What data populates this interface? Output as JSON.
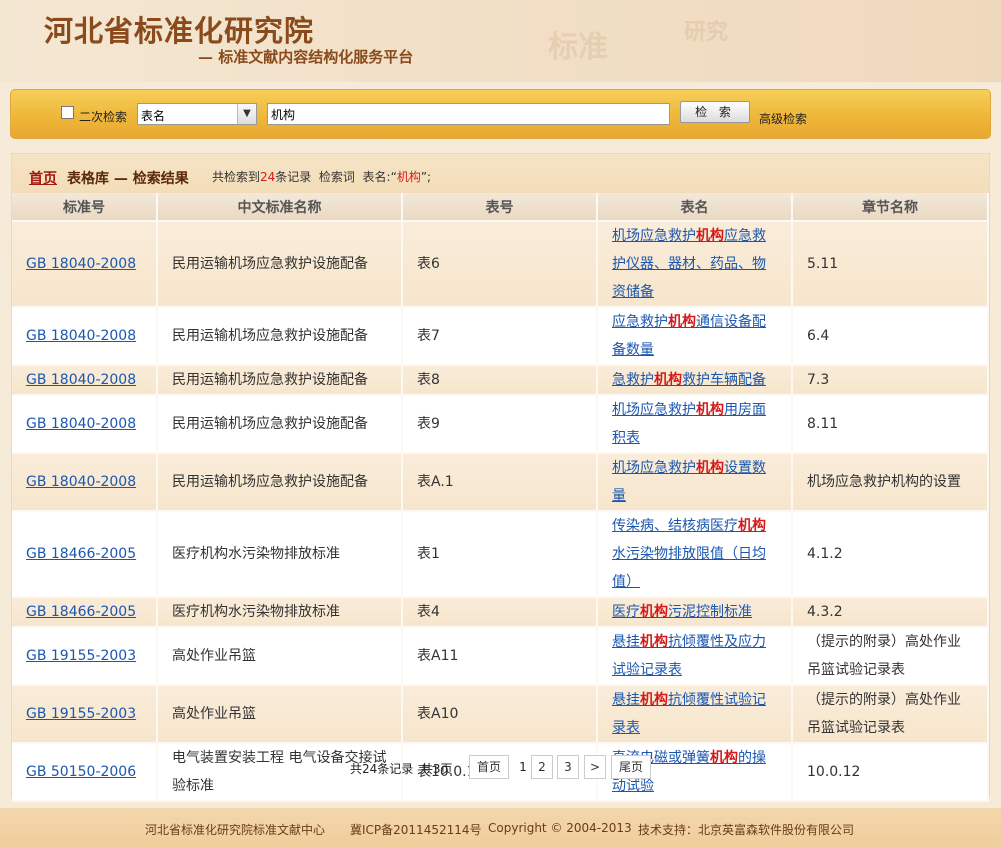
{
  "header": {
    "title": "河北省标准化研究院",
    "subtitle": "— 标准文献内容结构化服务平台",
    "watermark_1": "标准",
    "watermark_2": "研究"
  },
  "search": {
    "secondary_search_label": "二次检索",
    "secondary_search_checked": false,
    "field_select_value": "表名",
    "query_value": "机构",
    "search_button": "检 索",
    "advanced_link": "高级检索"
  },
  "breadcrumb": {
    "home": "首页",
    "rest": "表格库 — 检索结果",
    "stats_prefix": "共检索到",
    "count": "24",
    "stats_mid": "条记录  检索词  表名:“",
    "term": "机构",
    "stats_suffix": "”;"
  },
  "table": {
    "columns": [
      "标准号",
      "中文标准名称",
      "表号",
      "表名",
      "章节名称"
    ],
    "rows": [
      {
        "std": "GB 18040-2008",
        "name": "民用运输机场应急救护设施配备",
        "no": "表6",
        "title_pre": "机场应急救护",
        "title_hl": "机构",
        "title_post": "应急救护仪器、器材、药品、物资储备",
        "section": "5.11"
      },
      {
        "std": "GB 18040-2008",
        "name": "民用运输机场应急救护设施配备",
        "no": "表7",
        "title_pre": "应急救护",
        "title_hl": "机构",
        "title_post": "通信设备配备数量",
        "section": "6.4"
      },
      {
        "std": "GB 18040-2008",
        "name": "民用运输机场应急救护设施配备",
        "no": "表8",
        "title_pre": "急救护",
        "title_hl": "机构",
        "title_post": "救护车辆配备",
        "section": "7.3"
      },
      {
        "std": "GB 18040-2008",
        "name": "民用运输机场应急救护设施配备",
        "no": "表9",
        "title_pre": "机场应急救护",
        "title_hl": "机构",
        "title_post": "用房面积表",
        "section": "8.11"
      },
      {
        "std": "GB 18040-2008",
        "name": "民用运输机场应急救护设施配备",
        "no": "表A.1",
        "title_pre": "机场应急救护",
        "title_hl": "机构",
        "title_post": "设置数量",
        "section": "机场应急救护机构的设置"
      },
      {
        "std": "GB 18466-2005",
        "name": "医疗机构水污染物排放标准",
        "no": "表1",
        "title_pre": "传染病、结核病医疗",
        "title_hl": "机构",
        "title_post": "水污染物排放限值（日均值）",
        "section": "4.1.2"
      },
      {
        "std": "GB 18466-2005",
        "name": "医疗机构水污染物排放标准",
        "no": "表4",
        "title_pre": "医疗",
        "title_hl": "机构",
        "title_post": "污泥控制标准",
        "section": "4.3.2"
      },
      {
        "std": "GB 19155-2003",
        "name": "高处作业吊篮",
        "no": "表A11",
        "title_pre": "悬挂",
        "title_hl": "机构",
        "title_post": "抗倾覆性及应力试验记录表",
        "section": "（提示的附录）高处作业吊篮试验记录表"
      },
      {
        "std": "GB 19155-2003",
        "name": "高处作业吊篮",
        "no": "表A10",
        "title_pre": "悬挂",
        "title_hl": "机构",
        "title_post": "抗倾覆性试验记录表",
        "section": "（提示的附录）高处作业吊篮试验记录表"
      },
      {
        "std": "GB 50150-2006",
        "name": "电气装置安装工程 电气设备交接试验标准",
        "no": "表10.0.12-4",
        "title_pre": "直流电磁或弹簧",
        "title_hl": "机构",
        "title_post": "的操动试验",
        "section": "10.0.12"
      }
    ]
  },
  "pager": {
    "info": "共24条记录  共3页",
    "first": "首页",
    "current": "1",
    "p2": "2",
    "p3": "3",
    "next": ">",
    "last": "尾页"
  },
  "footer": {
    "org": "河北省标准化研究院标准文献中心",
    "icp": "冀ICP备2011452114号",
    "copyright": "Copyright © 2004-2013",
    "support": "技术支持：北京英富森软件股份有限公司"
  },
  "colors": {
    "accent_red": "#d41a1a",
    "link_blue": "#1a57b0",
    "brand_brown": "#8a4a1c",
    "search_bar_gold": "#efb73a"
  }
}
